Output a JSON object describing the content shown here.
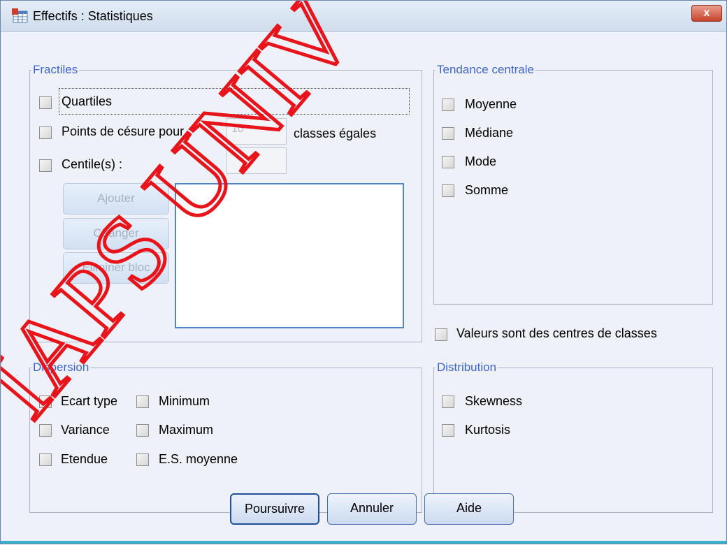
{
  "window": {
    "title": "Effectifs : Statistiques",
    "close_label": "x"
  },
  "fractiles": {
    "legend": "Fractiles",
    "quartiles": "Quartiles",
    "cut_points": "Points de césure pour :",
    "cut_points_value": "10",
    "cut_points_suffix": "classes égales",
    "percentiles": "Centile(s) :",
    "add": "Ajouter",
    "change": "Changer",
    "remove": "Eliminer bloc"
  },
  "central": {
    "legend": "Tendance centrale",
    "mean": "Moyenne",
    "median": "Médiane",
    "mode": "Mode",
    "sum": "Somme"
  },
  "group_midpoints": "Valeurs sont des centres de classes",
  "dispersion": {
    "legend": "Dispersion",
    "std_dev": "Ecart type",
    "variance": "Variance",
    "range": "Etendue",
    "minimum": "Minimum",
    "maximum": "Maximum",
    "se_mean": "E.S. moyenne"
  },
  "distribution": {
    "legend": "Distribution",
    "skewness": "Skewness",
    "kurtosis": "Kurtosis"
  },
  "buttons": {
    "continue": "Poursuivre",
    "cancel": "Annuler",
    "help": "Aide"
  },
  "watermark": {
    "text": "IAPS UNIV",
    "color": "#e8141b"
  }
}
